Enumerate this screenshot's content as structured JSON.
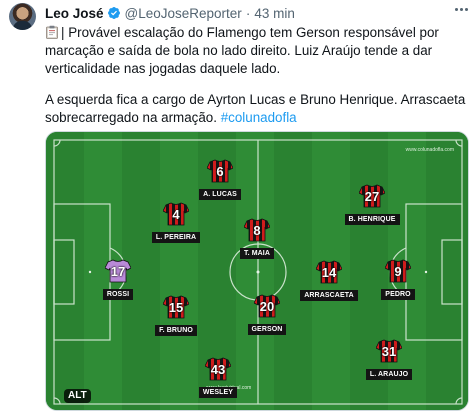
{
  "tweet": {
    "author_name": "Leo José",
    "handle": "@LeoJoseReporter",
    "separator": "·",
    "time": "43 min",
    "text_line1": "| Provável escalação do Flamengo tem Gerson responsável por marcação e saída de bola no lado direito. Luiz Araújo tende a dar verticalidade nas jogadas daquele lado.",
    "text_line2": "A esquerda fica a cargo de Ayrton Lucas e Bruno Henrique. Arrascaeta sobrecarregado na armação.",
    "hashtag": "#colunadofla"
  },
  "media": {
    "alt_label": "ALT",
    "credit_top": "www.colunadofla.com",
    "credit_bottom": "www.lacrivirtual.com",
    "players": [
      {
        "number": "6",
        "name": "A. LUCAS",
        "kit": "flamengo"
      },
      {
        "number": "27",
        "name": "B. HENRIQUE",
        "kit": "flamengo"
      },
      {
        "number": "4",
        "name": "L. PEREIRA",
        "kit": "flamengo"
      },
      {
        "number": "8",
        "name": "T. MAIA",
        "kit": "flamengo"
      },
      {
        "number": "17",
        "name": "ROSSI",
        "kit": "goalkeeper"
      },
      {
        "number": "14",
        "name": "ARRASCAETA",
        "kit": "flamengo"
      },
      {
        "number": "9",
        "name": "PEDRO",
        "kit": "flamengo"
      },
      {
        "number": "15",
        "name": "F. BRUNO",
        "kit": "flamengo"
      },
      {
        "number": "20",
        "name": "GERSON",
        "kit": "flamengo"
      },
      {
        "number": "31",
        "name": "L. ARAUJO",
        "kit": "flamengo"
      },
      {
        "number": "43",
        "name": "WESLEY",
        "kit": "flamengo"
      }
    ]
  },
  "colors": {
    "accent": "#1d9bf0",
    "verified_badge": "#1d9bf0",
    "flamengo_red": "#d01c1c",
    "flamengo_black": "#151515",
    "goalkeeper_purple": "#b98ad8",
    "pitch_green": "#2e8a35"
  },
  "icons": {
    "verified": "verified-badge-icon",
    "clipboard": "clipboard-icon",
    "more": "more-dots-icon"
  }
}
